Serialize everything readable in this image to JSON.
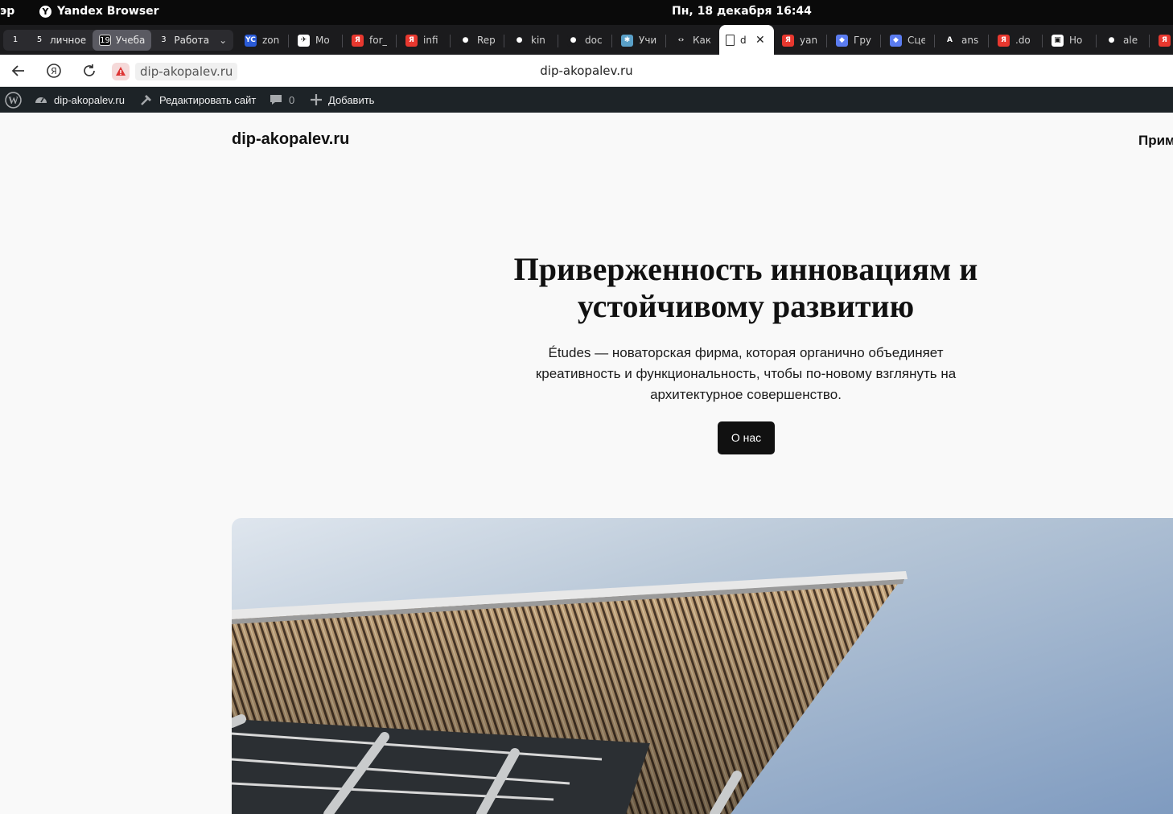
{
  "os": {
    "left_clip": "эр",
    "app_name": "Yandex Browser",
    "clock": "Пн, 18 декабря  16:44"
  },
  "tab_groups": [
    {
      "count": "1",
      "label": ""
    },
    {
      "count": "5",
      "label": "личное"
    },
    {
      "count": "19",
      "label": "Учеба",
      "active": true
    },
    {
      "count": "3",
      "label": "Работа"
    }
  ],
  "tabs": [
    {
      "title": "zon",
      "favicon": "yc-icon",
      "color": "#2a5bd7",
      "glyph": "YC"
    },
    {
      "title": "Mo",
      "favicon": "bot-icon",
      "color": "#ffffff",
      "glyph": "✈"
    },
    {
      "title": "for_",
      "favicon": "yandex-icon",
      "color": "#e8382f",
      "glyph": "Я"
    },
    {
      "title": "infi",
      "favicon": "yandex-icon",
      "color": "#e8382f",
      "glyph": "Я"
    },
    {
      "title": "Rep",
      "favicon": "github-icon",
      "color": "#1b1b1d",
      "glyph": "●"
    },
    {
      "title": "kin",
      "favicon": "github-icon",
      "color": "#1b1b1d",
      "glyph": "●"
    },
    {
      "title": "doc",
      "favicon": "github-icon",
      "color": "#1b1b1d",
      "glyph": "●"
    },
    {
      "title": "Учи",
      "favicon": "learn-icon",
      "color": "#5aa0c8",
      "glyph": "✱"
    },
    {
      "title": "Как",
      "favicon": "code-icon",
      "color": "#1b1b1d",
      "glyph": "‹›"
    },
    {
      "title": "d",
      "favicon": "page-icon",
      "color": "#ffffff",
      "glyph": "",
      "active": true
    },
    {
      "title": "yan",
      "favicon": "yandex-icon",
      "color": "#e8382f",
      "glyph": "Я"
    },
    {
      "title": "Гру",
      "favicon": "compass-icon",
      "color": "#5b7cf0",
      "glyph": "◆"
    },
    {
      "title": "Сце",
      "favicon": "compass-icon",
      "color": "#5b7cf0",
      "glyph": "◆"
    },
    {
      "title": "ans",
      "favicon": "a-icon",
      "color": "#1b1b1d",
      "glyph": "A"
    },
    {
      "title": ".do",
      "favicon": "yandex-icon",
      "color": "#e8382f",
      "glyph": "Я"
    },
    {
      "title": "Ho",
      "favicon": "notion-icon",
      "color": "#ffffff",
      "glyph": "▣"
    },
    {
      "title": "ale",
      "favicon": "github-icon",
      "color": "#1b1b1d",
      "glyph": "●"
    },
    {
      "title": "",
      "favicon": "yandex-icon",
      "color": "#e8382f",
      "glyph": "Я"
    }
  ],
  "address": {
    "url": "dip-akopalev.ru",
    "page_title": "dip-akopalev.ru"
  },
  "wp_admin": {
    "site": "dip-akopalev.ru",
    "edit": "Редактировать сайт",
    "comments": "0",
    "add": "Добавить"
  },
  "site": {
    "title": "dip-akopalev.ru",
    "nav_item": "Прим"
  },
  "hero": {
    "title": "Приверженность инновациям и устойчивому развитию",
    "text": "Études — новаторская фирма, которая органично объединяет креативность и функциональность, чтобы по-новому взглянуть на архитектурное совершенство.",
    "button": "О нас"
  },
  "colors": {
    "page_bg": "#f9f9f9",
    "admin_bar": "#1d2327",
    "button_bg": "#111111",
    "sky": "#8aa4c4"
  }
}
